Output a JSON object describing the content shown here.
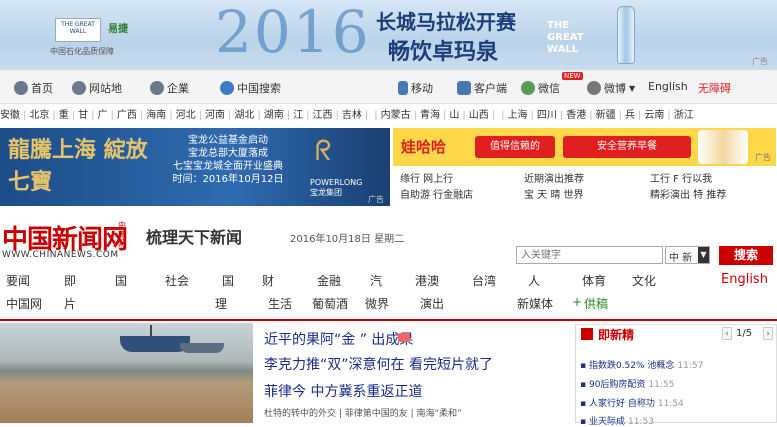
{
  "banner": {
    "logo_text": "THE GREAT WALL",
    "logo_brand": "易捷",
    "tagline": "中国石化品质保障",
    "year": "2016",
    "headline1": "长城马拉松开赛",
    "headline2": "畅饮卓玛泉",
    "side_text": "THE GREAT WALL",
    "ad_tag": "广告"
  },
  "nav": {
    "items": [
      {
        "label": "首页"
      },
      {
        "label": "网站地"
      },
      {
        "label": "企業"
      },
      {
        "label": "中国搜索"
      },
      {
        "label": "移动"
      },
      {
        "label": "客户端"
      },
      {
        "label": "微信"
      },
      {
        "label": "微博"
      },
      {
        "label": "English"
      },
      {
        "label": "无障碍"
      }
    ],
    "hot_badge": "NEW"
  },
  "provinces": [
    "安徽",
    "北京",
    "重",
    "甘",
    "广",
    "广西",
    "海南",
    "河北",
    "河南",
    "湖北",
    "湖南",
    "江",
    "江西",
    "吉林",
    "",
    "内蒙古",
    "青海",
    "山",
    "山西",
    "",
    "上海",
    "四川",
    "香港",
    "新疆",
    "兵",
    "云南",
    "浙江"
  ],
  "ad_left": {
    "calligraphy": "龍騰上海 綻放七寶",
    "lines": [
      "宝龙公益基金启动",
      "宝龙总部大厦落成",
      "七宝宝龙城全面开业盛典",
      "时间：2016年10月12日"
    ],
    "brand": "POWERLONG 宝龙集团",
    "ad_tag": "广告"
  },
  "ad_right": {
    "brand": "娃哈哈",
    "slogan1": "值得信赖的",
    "slogan2": "安全营养早餐",
    "ad_tag": "广告"
  },
  "ad_links": [
    [
      "缘行 网上行",
      "自助游 行金融店"
    ],
    [
      "近期演出推荐",
      "宝 天 晴 世界"
    ],
    [
      "工行 F 行以我",
      "精彩演出 特 推荐"
    ]
  ],
  "masthead": {
    "logo": "中国新闻网",
    "logo_sub": "中新网",
    "url": "WWW.CHINANEWS.COM",
    "slogan": "梳理天下新闻",
    "date": "2016年10月18日 星期二"
  },
  "search": {
    "placeholder": "入关键字",
    "scope": "中 新",
    "button": "搜索"
  },
  "categories_row1": [
    "要闻",
    "即",
    "国",
    "社会",
    "国",
    "财",
    "金融",
    "汽",
    "港澳",
    "台湾",
    "人",
    "体育",
    "文化",
    "English"
  ],
  "categories_row2": [
    "中国网",
    "片",
    "",
    "理",
    "生活",
    "葡萄酒",
    "微界",
    "演出",
    "",
    "新媒体",
    "供稿"
  ],
  "top_news": {
    "headlines": [
      "近平的果阿“金 ” 出成果",
      "李克力推“双”深意何在 看完短片就了",
      "菲律今 中方冀系重返正道"
    ],
    "subline": "杜特的转中的外交 | 菲律第中国的友 | 南海“柔和”"
  },
  "panel": {
    "title": "即新精",
    "page": "1/5",
    "items": [
      {
        "text": "指数跌0.52% 池概念",
        "time": "11:57"
      },
      {
        "text": "90后购房配资",
        "time": "11:55"
      },
      {
        "text": "人家行好 自称功",
        "time": "11:54"
      },
      {
        "text": "业天际成",
        "time": "11:53"
      }
    ]
  }
}
